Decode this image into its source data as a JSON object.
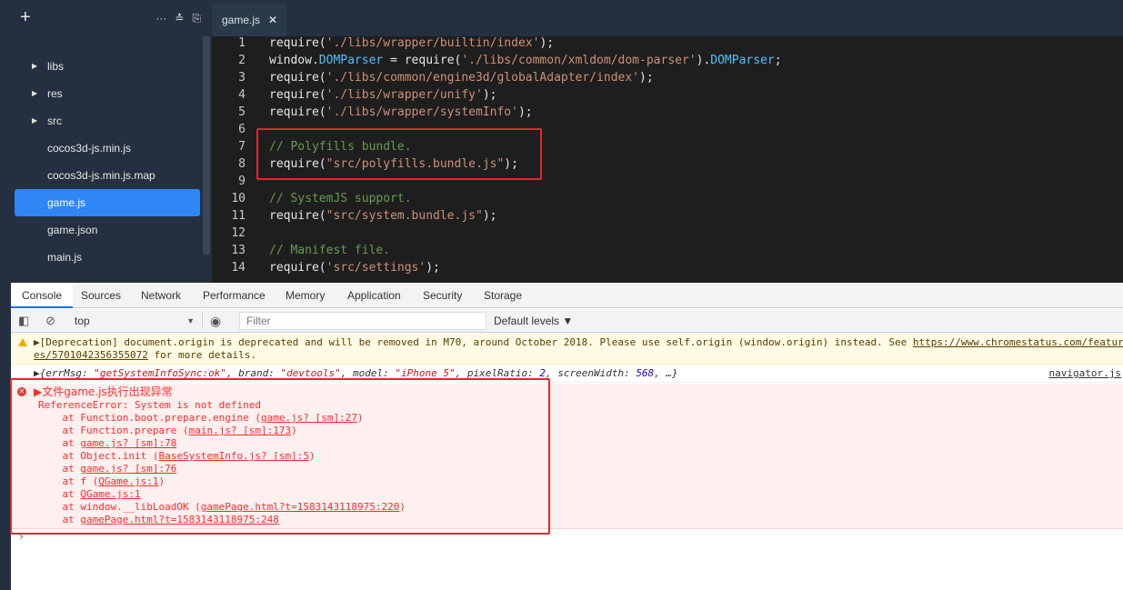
{
  "sidebar": {
    "add_icon": "plus-icon",
    "tools": [
      "more-icon",
      "collapse-icon",
      "new-file-icon"
    ],
    "items": [
      {
        "label": "libs",
        "folder": true
      },
      {
        "label": "res",
        "folder": true
      },
      {
        "label": "src",
        "folder": true
      },
      {
        "label": "cocos3d-js.min.js",
        "folder": false
      },
      {
        "label": "cocos3d-js.min.js.map",
        "folder": false
      },
      {
        "label": "game.js",
        "folder": false,
        "selected": true
      },
      {
        "label": "game.json",
        "folder": false
      },
      {
        "label": "main.js",
        "folder": false
      }
    ]
  },
  "editor": {
    "tab_label": "game.js",
    "tab_close": "✕",
    "lines": [
      {
        "n": "1",
        "text": "require('./libs/wrapper/builtin/index');"
      },
      {
        "n": "2",
        "text": "window.DOMParser = require('./libs/common/xmldom/dom-parser').DOMParser;"
      },
      {
        "n": "3",
        "text": "require('./libs/common/engine3d/globalAdapter/index');"
      },
      {
        "n": "4",
        "text": "require('./libs/wrapper/unify');"
      },
      {
        "n": "5",
        "text": "require('./libs/wrapper/systemInfo');"
      },
      {
        "n": "6",
        "text": ""
      },
      {
        "n": "7",
        "text": "// Polyfills bundle."
      },
      {
        "n": "8",
        "text": "require(\"src/polyfills.bundle.js\");"
      },
      {
        "n": "9",
        "text": ""
      },
      {
        "n": "10",
        "text": "// SystemJS support."
      },
      {
        "n": "11",
        "text": "require(\"src/system.bundle.js\");"
      },
      {
        "n": "12",
        "text": ""
      },
      {
        "n": "13",
        "text": "// Manifest file."
      },
      {
        "n": "14",
        "text": "require('src/settings');"
      }
    ]
  },
  "devtools": {
    "tabs": [
      "Console",
      "Sources",
      "Network",
      "Performance",
      "Memory",
      "Application",
      "Security",
      "Storage"
    ],
    "active_tab": "Console",
    "context": "top",
    "filter_placeholder": "Filter",
    "levels": "Default levels ▼",
    "warning": {
      "line1_pre": "▶[Deprecation] document.origin is deprecated and will be removed in M70, around October 2018. Please use self.origin (window.origin) instead. See ",
      "link_a": "https://www.chromestatus.com/featur",
      "link_b": "es/5701042356355072",
      "line2_post": " for more details."
    },
    "info": {
      "prefix": "▶{",
      "k1": "errMsg: ",
      "v1": "\"getSystemInfoSync:ok\"",
      "k2": ", brand: ",
      "v2": "\"devtools\"",
      "k3": ", model: ",
      "v3": "\"iPhone 5\"",
      "k4": ", pixelRatio: ",
      "v4": "2",
      "k5": ", screenWidth: ",
      "v5": "568",
      "suffix": ", …}",
      "source": "navigator.js"
    },
    "error": {
      "title": "▶文件game.js执行出现异常",
      "message": "ReferenceError: System is not defined",
      "stack": [
        {
          "pre": "    at Function.boot.prepare.engine (",
          "loc": "game.js? [sm]:27",
          "post": ")"
        },
        {
          "pre": "    at Function.prepare (",
          "loc": "main.js? [sm]:173",
          "post": ")"
        },
        {
          "pre": "    at ",
          "loc": "game.js? [sm]:78",
          "post": ""
        },
        {
          "pre": "    at Object.init (",
          "loc": "BaseSystemInfo.js? [sm]:5",
          "post": ")"
        },
        {
          "pre": "    at ",
          "loc": "game.js? [sm]:76",
          "post": ""
        },
        {
          "pre": "    at f (",
          "loc": "QGame.js:1",
          "post": ")"
        },
        {
          "pre": "    at ",
          "loc": "QGame.js:1",
          "post": ""
        },
        {
          "pre": "    at window.__libLoadOK (",
          "loc": "gamePage.html?t=1583143118975:220",
          "post": ")"
        },
        {
          "pre": "    at ",
          "loc": "gamePage.html?t=1583143118975:248",
          "post": ""
        }
      ]
    },
    "prompt": "›"
  }
}
